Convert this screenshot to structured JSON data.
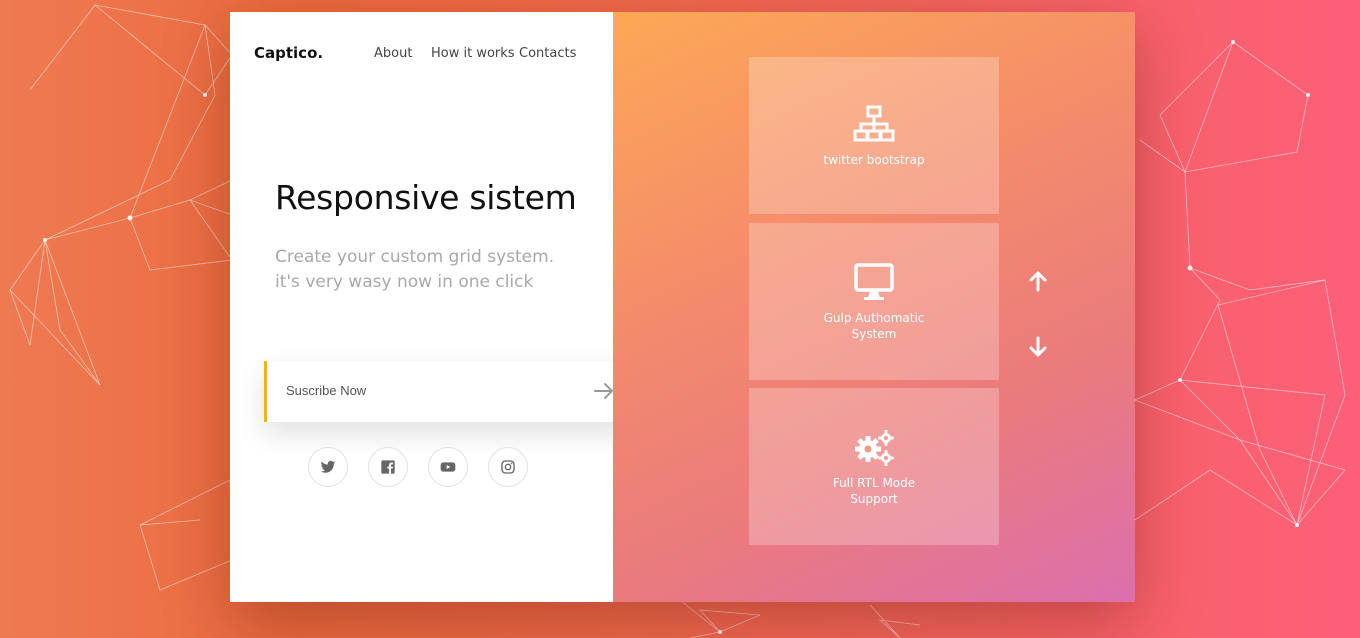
{
  "brand": {
    "logo": "Captico."
  },
  "nav": {
    "about": "About",
    "how": "How it works",
    "contacts": "Contacts"
  },
  "hero": {
    "title": "Responsive sistem",
    "subtitle_line1": "Create your custom grid system.",
    "subtitle_line2": "it's very wasy now in one click"
  },
  "subscribe": {
    "label": "Suscribe Now",
    "icon": "arrow-right-icon"
  },
  "social": [
    "twitter-icon",
    "facebook-icon",
    "youtube-icon",
    "instagram-icon"
  ],
  "features": [
    {
      "icon": "sitemap-icon",
      "line1": "twitter bootstrap",
      "line2": ""
    },
    {
      "icon": "desktop-icon",
      "line1": "Gulp Authomatic",
      "line2": "System"
    },
    {
      "icon": "gears-icon",
      "line1": "Full RTL Mode",
      "line2": "Support"
    }
  ],
  "slider_controls": {
    "up": "arrow-up-icon",
    "down": "arrow-down-icon"
  },
  "colors": {
    "background_left": "#ec6a3e",
    "background_right": "#fd5f79",
    "accent_border": "#f2b01e",
    "panel_gradient_start": "#fda856",
    "panel_gradient_end": "#dc6fae"
  }
}
